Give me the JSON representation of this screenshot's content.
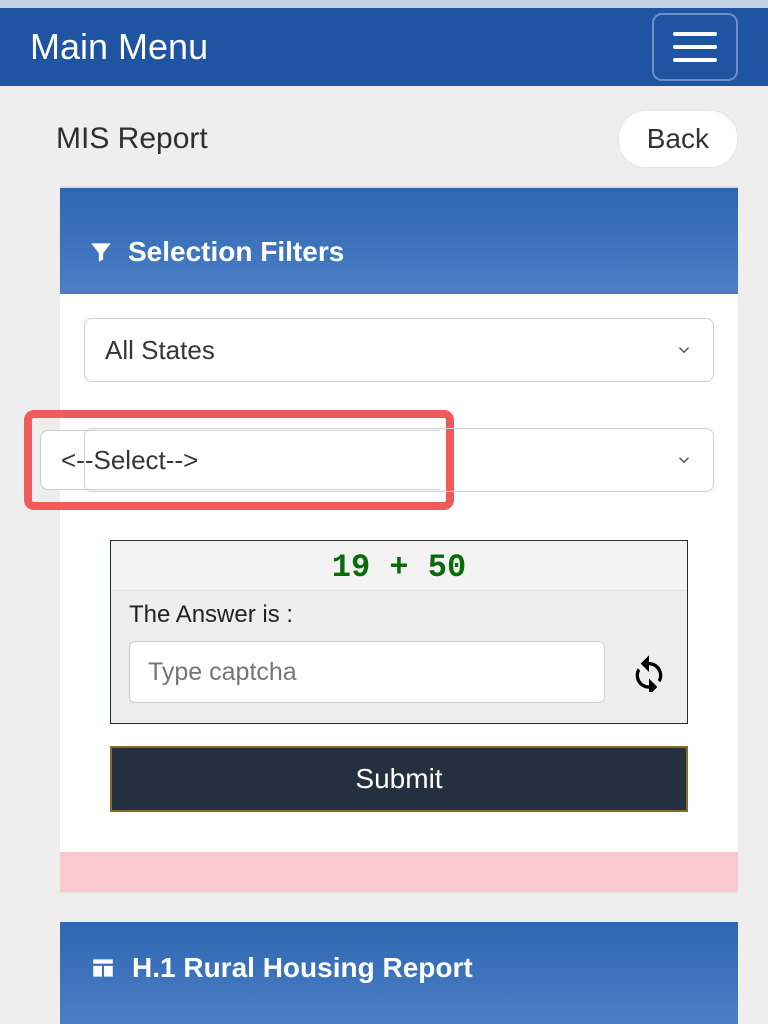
{
  "header": {
    "title": "Main Menu"
  },
  "subheader": {
    "title": "MIS Report",
    "back_label": "Back"
  },
  "filters": {
    "panel_title": "Selection Filters",
    "state_select_value": "All States",
    "second_select_value": "<--Select-->"
  },
  "captcha": {
    "question": "19 + 50",
    "label": "The Answer is :",
    "placeholder": "Type captcha"
  },
  "actions": {
    "submit_label": "Submit"
  },
  "report": {
    "title": "H.1 Rural Housing Report"
  }
}
